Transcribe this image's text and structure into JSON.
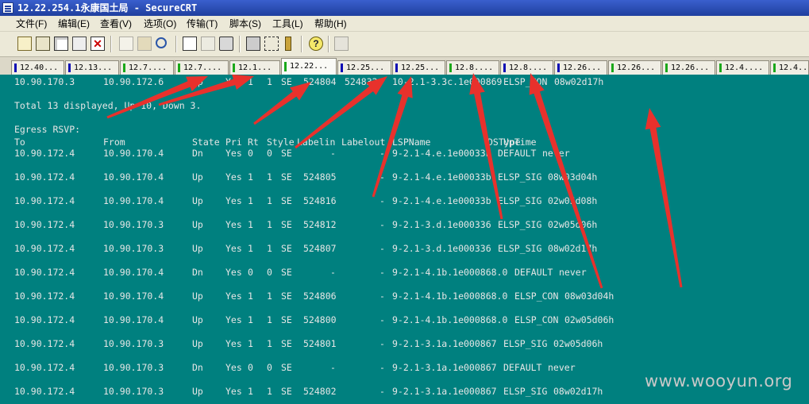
{
  "window": {
    "title": "12.22.254.1永康国土局 - SecureCRT"
  },
  "menu": [
    "文件(F)",
    "编辑(E)",
    "查看(V)",
    "选项(O)",
    "传输(T)",
    "脚本(S)",
    "工具(L)",
    "帮助(H)"
  ],
  "toolbar_icons": [
    "connect-icon",
    "quick-connect-icon",
    "connect-tab-icon",
    "reconnect-icon",
    "disconnect-icon",
    "copy-icon",
    "paste-icon",
    "find-icon",
    "print-setup-icon",
    "print-selection-icon",
    "print-icon",
    "session-options-icon",
    "global-options-icon",
    "keymap-icon",
    "help-icon",
    "script-icon"
  ],
  "tabs": [
    {
      "label": "12.40...",
      "indicator": "#0a0ab4"
    },
    {
      "label": "12.13...",
      "indicator": "#0a0ab4"
    },
    {
      "label": "12.7....",
      "indicator": "#1aa81a"
    },
    {
      "label": "12.7....",
      "indicator": "#1aa81a"
    },
    {
      "label": "12.1...",
      "indicator": "#1aa81a"
    },
    {
      "label": "12.22...",
      "indicator": "#1aa81a",
      "active": true
    },
    {
      "label": "12.25...",
      "indicator": "#0a0ab4"
    },
    {
      "label": "12.25...",
      "indicator": "#0a0ab4"
    },
    {
      "label": "12.8....",
      "indicator": "#1aa81a"
    },
    {
      "label": "12.8....",
      "indicator": "#0a0ab4"
    },
    {
      "label": "12.26...",
      "indicator": "#0a0ab4"
    },
    {
      "label": "12.26...",
      "indicator": "#1aa81a"
    },
    {
      "label": "12.26...",
      "indicator": "#1aa81a"
    },
    {
      "label": "12.4....",
      "indicator": "#1aa81a"
    },
    {
      "label": "12.4....",
      "indicator": "#1aa81a"
    }
  ],
  "terminal": {
    "first_row": [
      "10.90.170.3",
      "10.90.172.6",
      "Up",
      "Yes",
      "1",
      "1",
      "SE",
      "524804",
      "524832",
      "10-2.1-3.3c.1e000869",
      "ELSP_CON",
      "08w02d17h"
    ],
    "summary": "Total 13 displayed, Up 10, Down 3.",
    "section_title": "Egress RSVP:",
    "headers": [
      "To",
      "From",
      "State",
      "Pri",
      "Rt",
      "Style",
      "Labelin",
      "Labelout",
      "LSPName",
      "DSType",
      "UpTime"
    ],
    "rows": [
      [
        "10.90.172.4",
        "10.90.170.4",
        "Dn",
        "Yes",
        "0",
        "0",
        "SE",
        "-",
        "-",
        "9-2.1-4.e.1e00033b",
        "DEFAULT",
        "never"
      ],
      [
        "10.90.172.4",
        "10.90.170.4",
        "Up",
        "Yes",
        "1",
        "1",
        "SE",
        "524805",
        "-",
        "9-2.1-4.e.1e00033b",
        "ELSP_SIG",
        "08w03d04h"
      ],
      [
        "10.90.172.4",
        "10.90.170.4",
        "Up",
        "Yes",
        "1",
        "1",
        "SE",
        "524816",
        "-",
        "9-2.1-4.e.1e00033b",
        "ELSP_SIG",
        "02w05d08h"
      ],
      [
        "10.90.172.4",
        "10.90.170.3",
        "Up",
        "Yes",
        "1",
        "1",
        "SE",
        "524812",
        "-",
        "9-2.1-3.d.1e000336",
        "ELSP_SIG",
        "02w05d06h"
      ],
      [
        "10.90.172.4",
        "10.90.170.3",
        "Up",
        "Yes",
        "1",
        "1",
        "SE",
        "524807",
        "-",
        "9-2.1-3.d.1e000336",
        "ELSP_SIG",
        "08w02d17h"
      ],
      [
        "10.90.172.4",
        "10.90.170.4",
        "Dn",
        "Yes",
        "0",
        "0",
        "SE",
        "-",
        "-",
        "9-2.1-4.1b.1e000868.0",
        "DEFAULT",
        "never"
      ],
      [
        "10.90.172.4",
        "10.90.170.4",
        "Up",
        "Yes",
        "1",
        "1",
        "SE",
        "524806",
        "-",
        "9-2.1-4.1b.1e000868.0",
        "ELSP_CON",
        "08w03d04h"
      ],
      [
        "10.90.172.4",
        "10.90.170.4",
        "Up",
        "Yes",
        "1",
        "1",
        "SE",
        "524800",
        "-",
        "9-2.1-4.1b.1e000868.0",
        "ELSP_CON",
        "02w05d06h"
      ],
      [
        "10.90.172.4",
        "10.90.170.3",
        "Up",
        "Yes",
        "1",
        "1",
        "SE",
        "524801",
        "-",
        "9-2.1-3.1a.1e000867",
        "ELSP_SIG",
        "02w05d06h"
      ],
      [
        "10.90.172.4",
        "10.90.170.3",
        "Dn",
        "Yes",
        "0",
        "0",
        "SE",
        "-",
        "-",
        "9-2.1-3.1a.1e000867",
        "DEFAULT",
        "never"
      ],
      [
        "10.90.172.4",
        "10.90.170.3",
        "Up",
        "Yes",
        "1",
        "1",
        "SE",
        "524802",
        "-",
        "9-2.1-3.1a.1e000867",
        "ELSP_SIG",
        "08w02d17h"
      ]
    ]
  },
  "watermark": "www.wooyun.org",
  "colors": {
    "terminal_bg": "#00807f",
    "terminal_text": "#e6e6e6",
    "annotation_arrow": "#e8312c",
    "titlebar": "#2a4cb8"
  }
}
